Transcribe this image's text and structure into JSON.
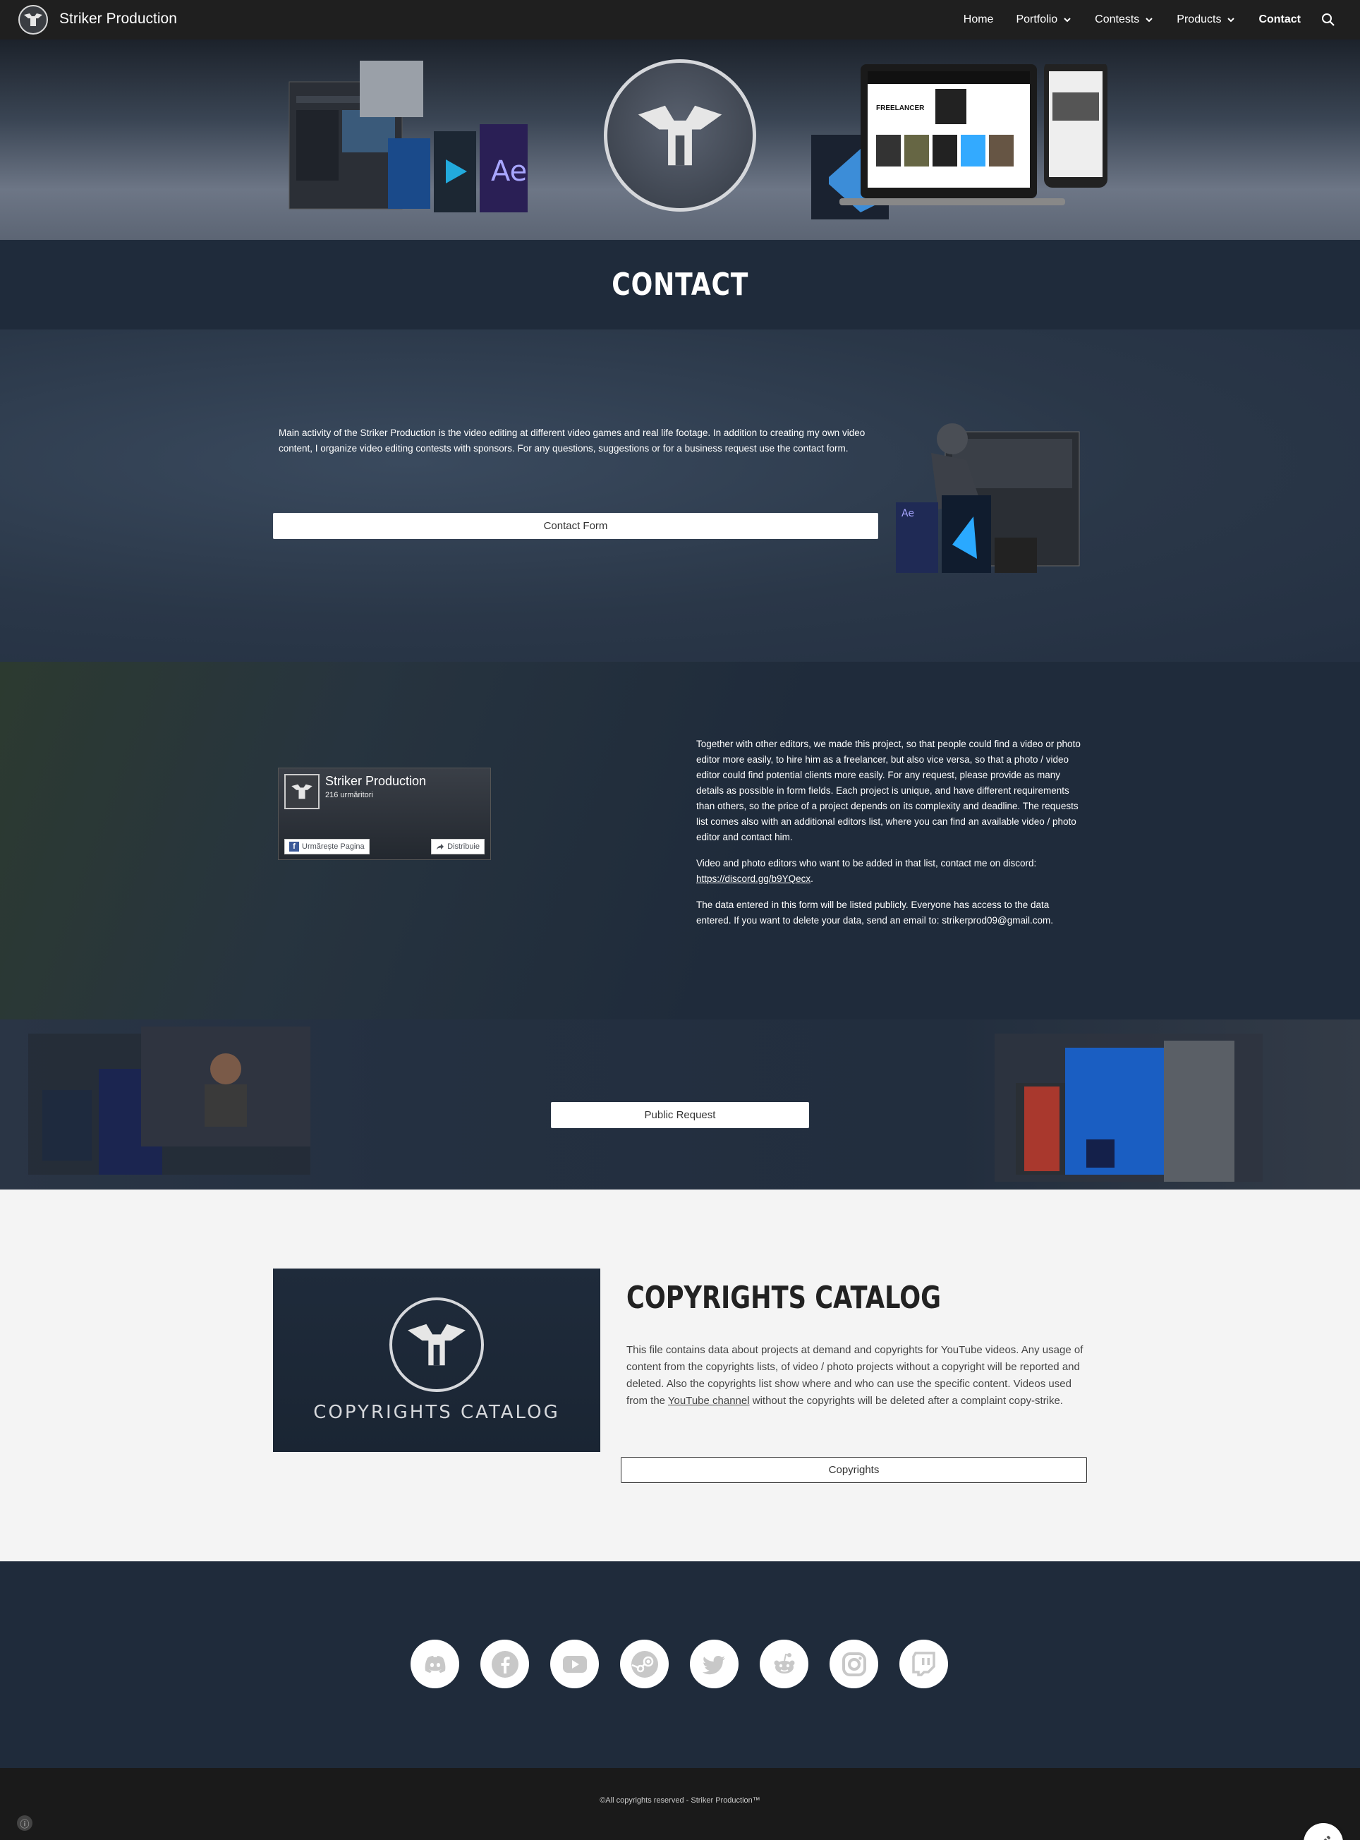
{
  "header": {
    "site_title": "Striker Production",
    "nav": [
      {
        "label": "Home",
        "has_menu": false
      },
      {
        "label": "Portfolio",
        "has_menu": true
      },
      {
        "label": "Contests",
        "has_menu": true
      },
      {
        "label": "Products",
        "has_menu": true
      },
      {
        "label": "Contact",
        "has_menu": false,
        "active": true
      }
    ]
  },
  "page": {
    "title": "CONTACT"
  },
  "contact_section": {
    "text": "Main activity of the Striker Production is the video editing at different video games and real life footage. In addition to creating my own video content, I organize video editing contests with sponsors. For any questions, suggestions or for a business request use the contact form.",
    "button_label": "Contact Form"
  },
  "facebook_widget": {
    "page_name": "Striker Production",
    "followers": "216 urmăritori",
    "follow_label": "Urmărește Pagina",
    "share_label": "Distribuie"
  },
  "freelancer_section": {
    "paragraph1": "Together with other editors, we made this project, so that people could find a video or photo editor more easily, to hire him as a freelancer, but also vice versa, so that a photo / video editor could find potential clients more easily. For any request, please provide as many details as possible in form fields. Each project is unique, and have different requirements than others, so the price of a project depends on its complexity and deadline. The requests list comes also with an additional editors list, where you can find an available video / photo editor and contact him.",
    "paragraph2_prefix": "Video and photo editors who want to be added in that list, contact me on discord: ",
    "discord_link": "https://discord.gg/b9YQecx",
    "paragraph2_suffix": ".",
    "paragraph3": "The data entered in this form will be listed publicly. Everyone has access to the data entered. If you want to delete your data, send an email to: strikerprod09@gmail.com."
  },
  "public_request": {
    "button_label": "Public Request"
  },
  "copyrights": {
    "image_label": "COPYRIGHTS CATALOG",
    "title": "COPYRIGHTS CATALOG",
    "text_before_link": "This file contains data about projects at demand and copyrights for YouTube videos. Any usage of content from the copyrights lists, of video / photo projects without a copyright will be reported and deleted. Also the copyrights list show where and who can use the specific content. Videos used from the ",
    "link_text": "YouTube channel",
    "text_after_link": " without the copyrights will be deleted after a complaint copy-strike.",
    "button_label": "Copyrights"
  },
  "social_icons": [
    "discord-icon",
    "facebook-icon",
    "youtube-icon",
    "steam-icon",
    "twitter-icon",
    "reddit-icon",
    "instagram-icon",
    "twitch-icon"
  ],
  "footer": {
    "copyright": "©All copyrights reserved - Striker Production™"
  },
  "colors": {
    "nav_bg": "#1f1f1f",
    "band_bg": "#1f2b3b",
    "light_bg": "#f4f4f4",
    "footer_bg": "#1a1a1a"
  }
}
